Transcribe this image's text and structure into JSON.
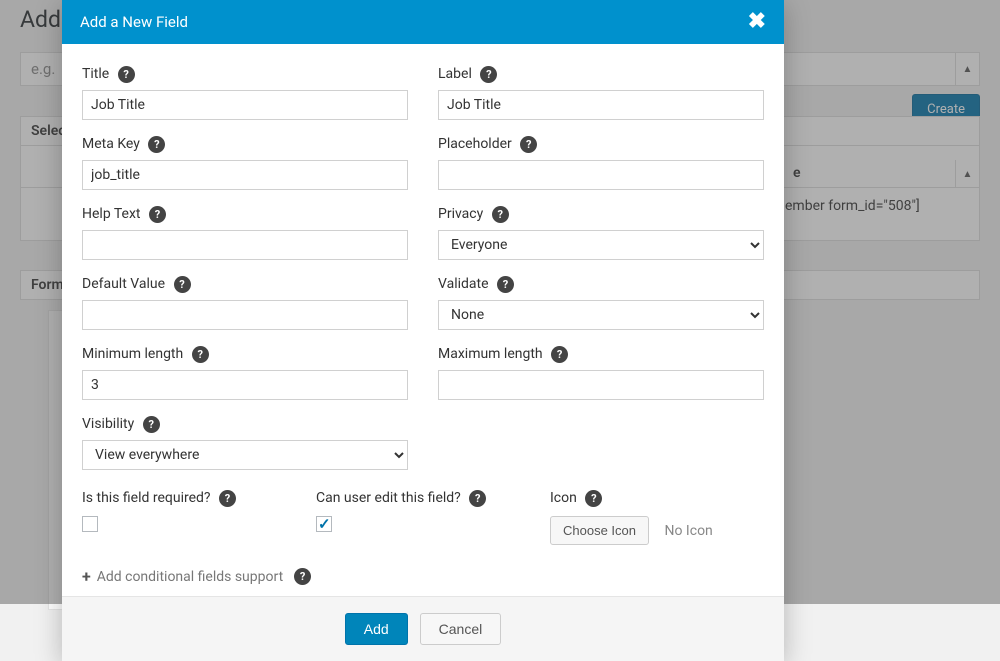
{
  "background": {
    "page_title": "Add",
    "input_placeholder": "e.g.",
    "create_button": "Create",
    "select_label": "Selec",
    "form_header": "Form",
    "row_name_fragment": "e",
    "row_shortcode_fragment": "ember form_id=\"508\"]"
  },
  "modal": {
    "title": "Add a New Field",
    "left": {
      "title": {
        "label": "Title",
        "value": "Job Title"
      },
      "meta_key": {
        "label": "Meta Key",
        "value": "job_title"
      },
      "help_text": {
        "label": "Help Text",
        "value": ""
      },
      "default_value": {
        "label": "Default Value",
        "value": ""
      },
      "min_length": {
        "label": "Minimum length",
        "value": "3"
      },
      "visibility": {
        "label": "Visibility",
        "value": "View everywhere"
      }
    },
    "right": {
      "label": {
        "label": "Label",
        "value": "Job Title"
      },
      "placeholder": {
        "label": "Placeholder",
        "value": ""
      },
      "privacy": {
        "label": "Privacy",
        "value": "Everyone"
      },
      "validate": {
        "label": "Validate",
        "value": "None"
      },
      "max_length": {
        "label": "Maximum length",
        "value": ""
      }
    },
    "three": {
      "required": {
        "label": "Is this field required?",
        "checked": false
      },
      "editable": {
        "label": "Can user edit this field?",
        "checked": true
      },
      "icon": {
        "label": "Icon",
        "button": "Choose Icon",
        "status": "No Icon"
      }
    },
    "conditional": "Add conditional fields support",
    "footer": {
      "add": "Add",
      "cancel": "Cancel"
    }
  }
}
